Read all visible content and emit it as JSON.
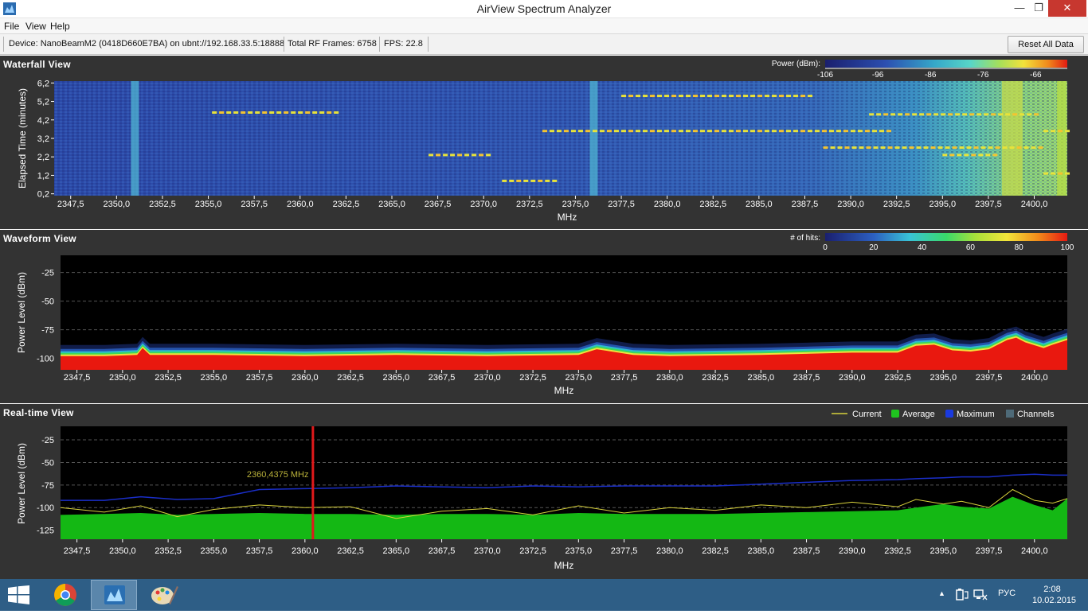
{
  "window": {
    "title": "AirView Spectrum Analyzer",
    "minimize_glyph": "—",
    "maximize_glyph": "❐",
    "close_glyph": "✕"
  },
  "menu": {
    "file": "File",
    "view": "View",
    "help": "Help"
  },
  "status": {
    "device": "Device: NanoBeamM2 (0418D660E7BA) on ubnt://192.168.33.5:18888",
    "frames": "Total RF Frames: 6758",
    "fps": "FPS: 22.8",
    "reset_label": "Reset All Data"
  },
  "waterfall": {
    "title": "Waterfall View",
    "legend_label": "Power (dBm):",
    "legend_ticks": [
      "-106",
      "-96",
      "-86",
      "-76",
      "-66"
    ],
    "y_label": "Elapsed Time (minutes)",
    "y_ticks": [
      "6,2",
      "5,2",
      "4,2",
      "3,2",
      "2,2",
      "1,2",
      "0,2"
    ],
    "x_label": "MHz"
  },
  "waveform": {
    "title": "Waveform View",
    "legend_label": "# of hits:",
    "legend_ticks": [
      "0",
      "20",
      "40",
      "60",
      "80",
      "100"
    ],
    "y_label": "Power Level (dBm)",
    "y_ticks": [
      "-25",
      "-50",
      "-75",
      "-100"
    ],
    "x_label": "MHz"
  },
  "realtime": {
    "title": "Real-time View",
    "legend": {
      "current": "Current",
      "average": "Average",
      "maximum": "Maximum",
      "channels": "Channels"
    },
    "marker_label": "2360,4375 MHz",
    "y_label": "Power Level (dBm)",
    "y_ticks": [
      "-25",
      "-50",
      "-75",
      "-100",
      "-125"
    ],
    "x_label": "MHz"
  },
  "x_ticks": [
    "2347,5",
    "2350,0",
    "2352,5",
    "2355,0",
    "2357,5",
    "2360,0",
    "2362,5",
    "2365,0",
    "2367,5",
    "2370,0",
    "2372,5",
    "2375,0",
    "2377,5",
    "2380,0",
    "2382,5",
    "2385,0",
    "2387,5",
    "2390,0",
    "2392,5",
    "2395,0",
    "2397,5",
    "2400,0"
  ],
  "chart_data": [
    {
      "type": "heatmap",
      "title": "Waterfall View",
      "xlabel": "MHz",
      "ylabel": "Elapsed Time (minutes)",
      "xlim": [
        2346.6,
        2401.8
      ],
      "ylim": [
        0.1,
        6.3
      ],
      "colorbar": {
        "label": "Power (dBm):",
        "range": [
          -106,
          -60
        ]
      },
      "bright_columns_mhz": [
        2351.0,
        2376.0,
        2398.8,
        2401.5
      ],
      "signal_bursts": [
        {
          "x_range": [
            2355.2,
            2362.0
          ],
          "y": 4.6
        },
        {
          "x_range": [
            2367.0,
            2370.5
          ],
          "y": 2.3
        },
        {
          "x_range": [
            2371.0,
            2374.0
          ],
          "y": 0.9
        },
        {
          "x_range": [
            2373.2,
            2392.0
          ],
          "y": 3.6
        },
        {
          "x_range": [
            2377.5,
            2388.0
          ],
          "y": 5.5
        },
        {
          "x_range": [
            2391.0,
            2400.0
          ],
          "y": 4.5
        },
        {
          "x_range": [
            2388.5,
            2400.5
          ],
          "y": 2.7
        },
        {
          "x_range": [
            2395.0,
            2398.0
          ],
          "y": 2.3
        },
        {
          "x_range": [
            2400.5,
            2401.8
          ],
          "y": 1.3
        },
        {
          "x_range": [
            2400.5,
            2401.8
          ],
          "y": 3.6
        }
      ]
    },
    {
      "type": "area",
      "title": "Waveform View",
      "xlabel": "MHz",
      "ylabel": "Power Level (dBm)",
      "xlim": [
        2346.6,
        2401.8
      ],
      "ylim": [
        -110,
        -10
      ],
      "colorbar": {
        "label": "# of hits:",
        "range": [
          0,
          100
        ]
      },
      "x": [
        2346.6,
        2349.0,
        2350.8,
        2351.1,
        2351.5,
        2355.0,
        2360.0,
        2365.0,
        2370.0,
        2375.0,
        2376.0,
        2378.0,
        2380.0,
        2385.0,
        2387.5,
        2390.0,
        2392.5,
        2393.5,
        2394.5,
        2395.5,
        2396.5,
        2397.5,
        2398.5,
        2399.0,
        2399.5,
        2400.5,
        2401.0,
        2401.8
      ],
      "values": [
        -98,
        -98,
        -97,
        -91,
        -97,
        -97,
        -98,
        -97,
        -98,
        -97,
        -92,
        -97,
        -98,
        -97,
        -96,
        -95,
        -95,
        -89,
        -88,
        -93,
        -94,
        -92,
        -84,
        -82,
        -86,
        -91,
        -88,
        -84
      ]
    },
    {
      "type": "line",
      "title": "Real-time View",
      "xlabel": "MHz",
      "ylabel": "Power Level (dBm)",
      "xlim": [
        2346.6,
        2401.8
      ],
      "ylim": [
        -135,
        -10
      ],
      "marker_mhz": 2360.4375,
      "x": [
        2346.6,
        2349.0,
        2351.0,
        2353.0,
        2355.0,
        2357.5,
        2360.0,
        2362.5,
        2365.0,
        2367.5,
        2370.0,
        2372.5,
        2375.0,
        2377.5,
        2380.0,
        2382.5,
        2385.0,
        2387.5,
        2390.0,
        2392.5,
        2393.5,
        2395.0,
        2396.0,
        2397.5,
        2398.8,
        2400.0,
        2401.0,
        2401.8
      ],
      "series": [
        {
          "name": "Current",
          "values": [
            -100,
            -105,
            -98,
            -110,
            -102,
            -97,
            -100,
            -99,
            -112,
            -104,
            -101,
            -108,
            -98,
            -106,
            -100,
            -103,
            -97,
            -100,
            -94,
            -99,
            -91,
            -96,
            -93,
            -100,
            -80,
            -92,
            -95,
            -90
          ]
        },
        {
          "name": "Average",
          "values": [
            -108,
            -107,
            -106,
            -108,
            -107,
            -106,
            -107,
            -107,
            -108,
            -107,
            -107,
            -108,
            -106,
            -107,
            -107,
            -107,
            -106,
            -105,
            -104,
            -103,
            -100,
            -96,
            -99,
            -101,
            -88,
            -97,
            -103,
            -90
          ]
        },
        {
          "name": "Maximum",
          "values": [
            -92,
            -92,
            -88,
            -91,
            -90,
            -80,
            -79,
            -78,
            -76,
            -77,
            -78,
            -76,
            -77,
            -76,
            -76,
            -76,
            -74,
            -72,
            -70,
            -69,
            -68,
            -67,
            -66,
            -66,
            -64,
            -63,
            -64,
            -64
          ]
        }
      ]
    }
  ]
}
